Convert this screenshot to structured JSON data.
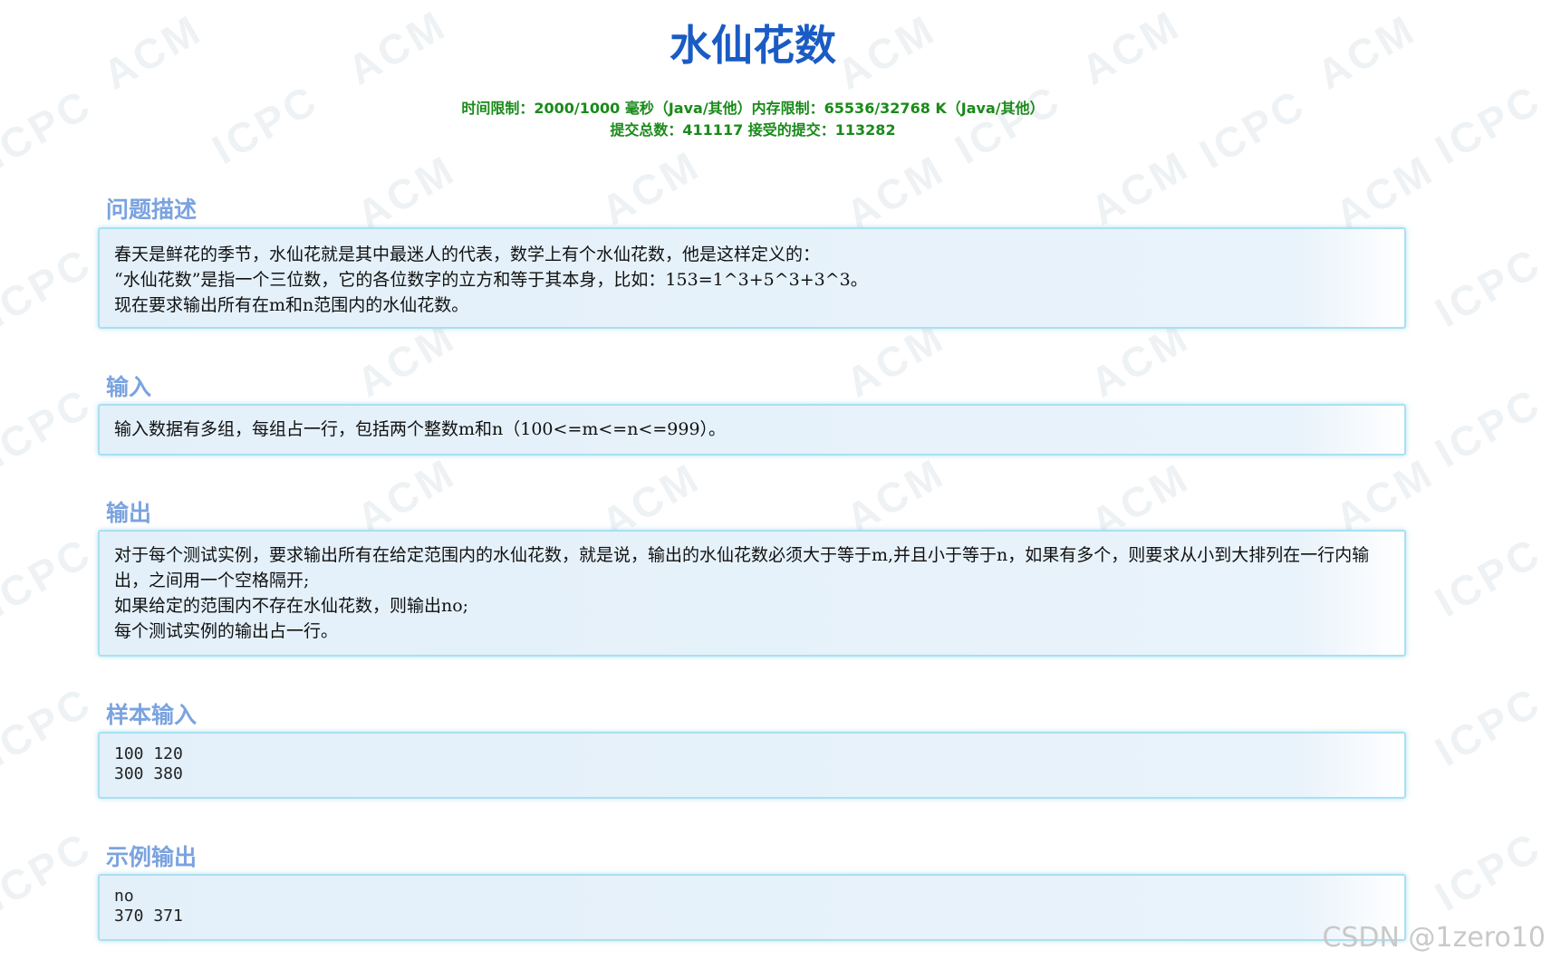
{
  "title": "水仙花数",
  "limits": {
    "line1": "时间限制：2000/1000 毫秒（Java/其他）内存限制：65536/32768 K（Java/其他）",
    "line2": "提交总数：411117 接受的提交：113282"
  },
  "sections": [
    {
      "title": "问题描述",
      "lines": [
        "春天是鲜花的季节，水仙花就是其中最迷人的代表，数学上有个水仙花数，他是这样定义的：",
        "“水仙花数”是指一个三位数，它的各位数字的立方和等于其本身，比如：153=1^3+5^3+3^3。",
        "现在要求输出所有在m和n范围内的水仙花数。"
      ]
    },
    {
      "title": "输入",
      "lines": [
        "输入数据有多组，每组占一行，包括两个整数m和n（100<=m<=n<=999）。"
      ]
    },
    {
      "title": "输出",
      "lines": [
        "对于每个测试实例，要求输出所有在给定范围内的水仙花数，就是说，输出的水仙花数必须大于等于m,并且小于等于n，如果有多个，则要求从小到大排列在一行内输出，之间用一个空格隔开;",
        "如果给定的范围内不存在水仙花数，则输出no;",
        "每个测试实例的输出占一行。"
      ]
    },
    {
      "title": "样本输入",
      "lines": [
        "100 120",
        "300 380"
      ]
    },
    {
      "title": "示例输出",
      "lines": [
        "no",
        "370 371"
      ]
    }
  ],
  "watermark": {
    "acm": "ACM",
    "icpc": "ICPC"
  },
  "credit": "CSDN @1zero10"
}
